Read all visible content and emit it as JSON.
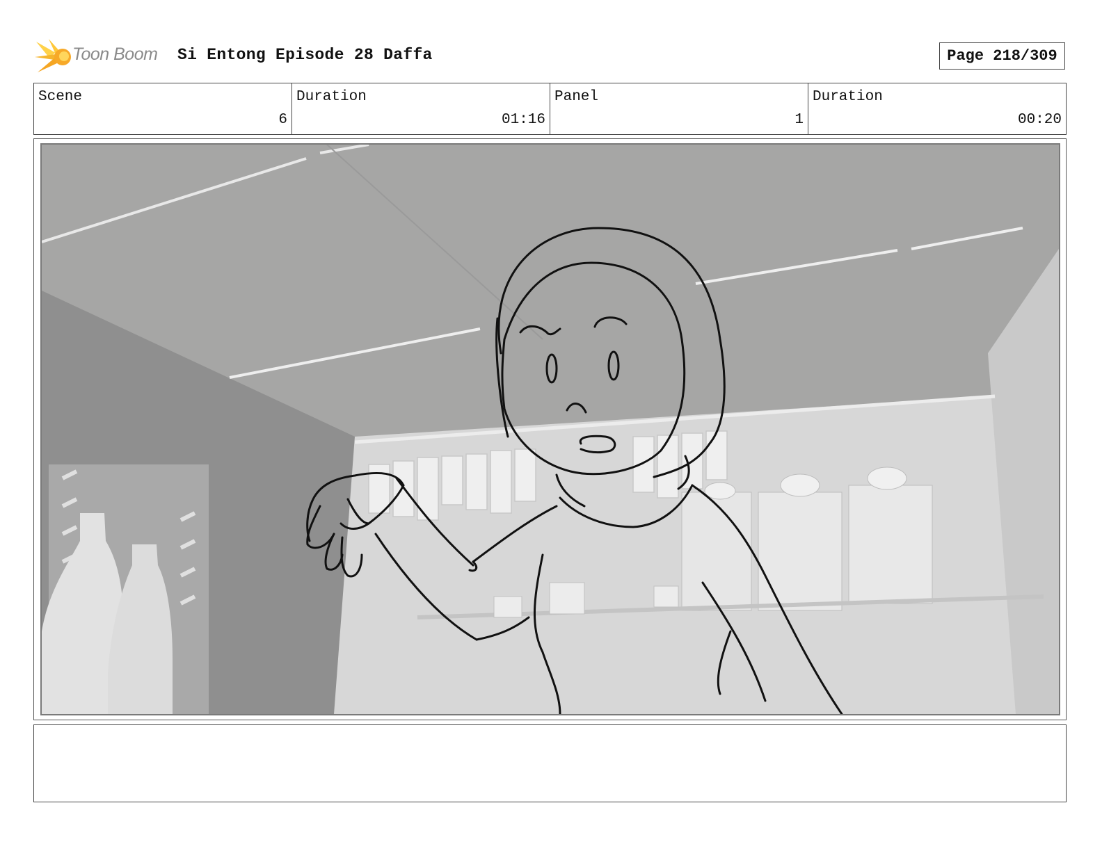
{
  "header": {
    "logo_text": "Toon Boom",
    "title": "Si Entong Episode 28 Daffa",
    "page": "Page 218/309"
  },
  "info": {
    "scene_label": "Scene",
    "scene_value": "6",
    "scene_duration_label": "Duration",
    "scene_duration_value": "01:16",
    "panel_label": "Panel",
    "panel_value": "1",
    "panel_duration_label": "Duration",
    "panel_duration_value": "00:20"
  },
  "notes": {
    "text": ""
  },
  "colors": {
    "logo_orange": "#f5a623",
    "logo_yellow": "#ffd24a",
    "frame_border": "#444444"
  }
}
